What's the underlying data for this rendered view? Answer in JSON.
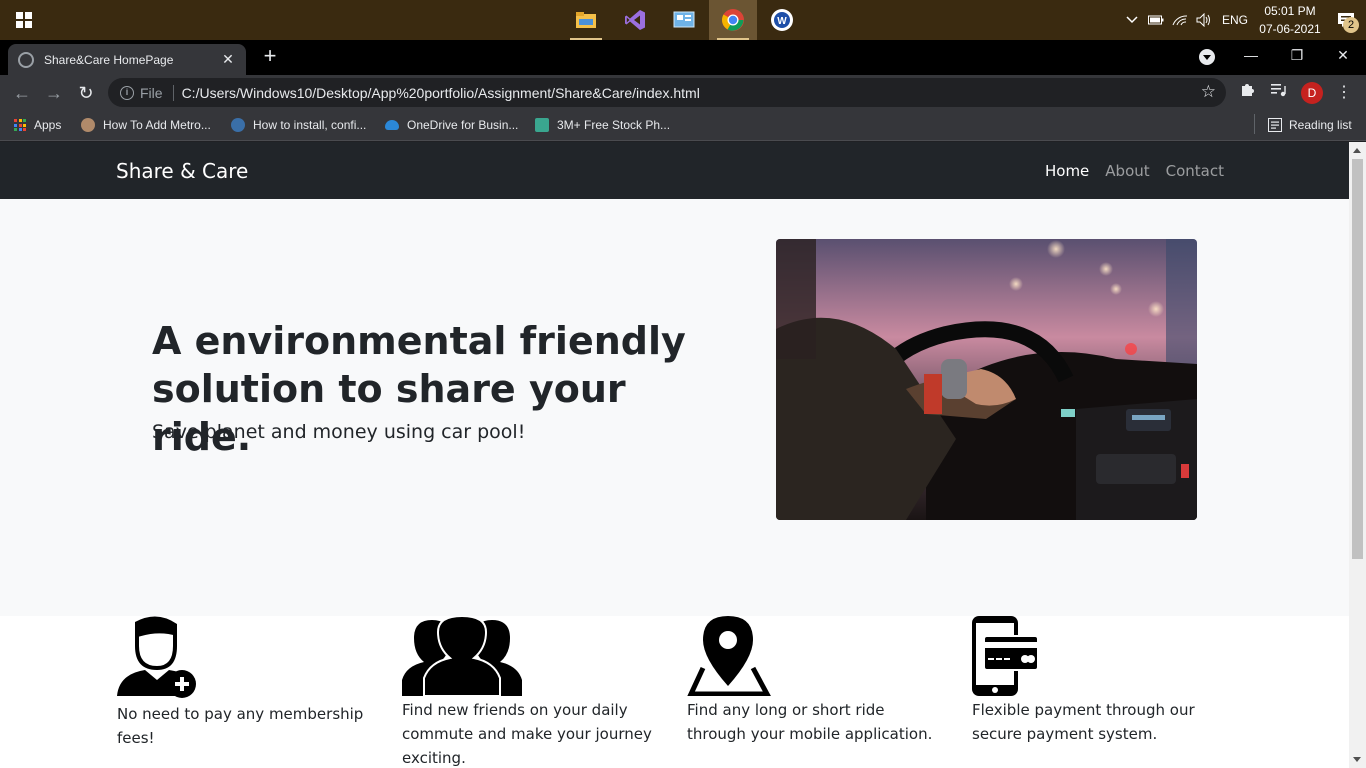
{
  "taskbar": {
    "apps": [
      "file-explorer",
      "visual-studio",
      "control-panel",
      "chrome",
      "word-app"
    ],
    "tray": {
      "language": "ENG",
      "time": "05:01 PM",
      "date": "07-06-2021",
      "notifications": "2"
    }
  },
  "browser": {
    "tab_title": "Share&Care HomePage",
    "address_scheme_label": "File",
    "address_url": "C:/Users/Windows10/Desktop/App%20portfolio/Assignment/Share&Care/index.html",
    "profile_initial": "D",
    "bookmarks": [
      {
        "label": "Apps",
        "icon": "apps-grid-icon"
      },
      {
        "label": "How To Add Metro...",
        "icon": "bookmark-favicon"
      },
      {
        "label": "How to install, confi...",
        "icon": "bookmark-favicon"
      },
      {
        "label": "OneDrive for Busin...",
        "icon": "onedrive-icon"
      },
      {
        "label": "3M+ Free Stock Ph...",
        "icon": "bookmark-favicon"
      }
    ],
    "reading_list": "Reading list"
  },
  "page": {
    "brand": "Share & Care",
    "nav": [
      {
        "label": "Home",
        "active": true
      },
      {
        "label": "About",
        "active": false
      },
      {
        "label": "Contact",
        "active": false
      }
    ],
    "hero": {
      "heading": "A environmental friendly solution to share your ride.",
      "subtitle": "Save planet and money using car pool!",
      "image": "driver-steering-wheel-photo"
    },
    "features": [
      {
        "icon": "user-add-icon",
        "text": "No need to pay any membership fees!"
      },
      {
        "icon": "group-icon",
        "text": "Find new friends on your daily commute and make your journey exciting."
      },
      {
        "icon": "map-pin-icon",
        "text": "Find any long or short ride through your mobile application."
      },
      {
        "icon": "mobile-payment-icon",
        "text": "Flexible payment through our secure payment system."
      }
    ]
  },
  "colors": {
    "navbar": "#212529",
    "hero_bg": "#f8f9fa",
    "taskbar": "#3a2a10",
    "chrome_frame": "#35363a"
  }
}
